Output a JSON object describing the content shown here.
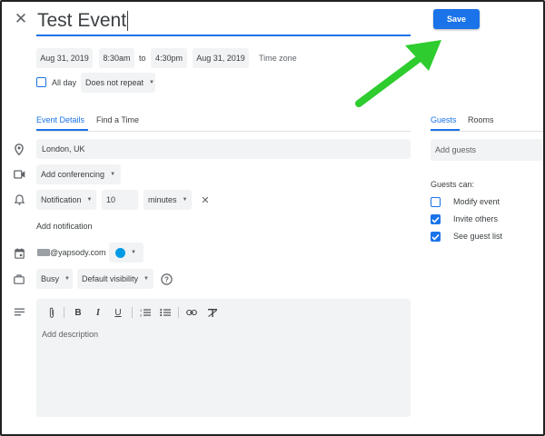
{
  "event": {
    "title": "Test Event",
    "save_label": "Save"
  },
  "datetime": {
    "start_date": "Aug 31, 2019",
    "start_time": "8:30am",
    "to_label": "to",
    "end_time": "4:30pm",
    "end_date": "Aug 31, 2019",
    "time_zone_label": "Time zone"
  },
  "options": {
    "all_day_label": "All day",
    "repeat_value": "Does not repeat"
  },
  "tabs": {
    "event_details": "Event Details",
    "find_time": "Find a Time"
  },
  "details": {
    "location": "London, UK",
    "conferencing": "Add conferencing",
    "notification_type": "Notification",
    "notification_value": "10",
    "notification_unit": "minutes",
    "add_notification": "Add notification",
    "calendar_owner": "@yapsody.com",
    "calendar_color": "#039be5",
    "availability": "Busy",
    "visibility": "Default visibility",
    "description_placeholder": "Add description"
  },
  "guests_panel": {
    "tab_guests": "Guests",
    "tab_rooms": "Rooms",
    "add_guests_placeholder": "Add guests",
    "guests_can_label": "Guests can:",
    "permissions": [
      {
        "label": "Modify event",
        "checked": false
      },
      {
        "label": "Invite others",
        "checked": true
      },
      {
        "label": "See guest list",
        "checked": true
      }
    ]
  },
  "colors": {
    "accent": "#1a73e8",
    "arrow": "#2ecc2e"
  }
}
